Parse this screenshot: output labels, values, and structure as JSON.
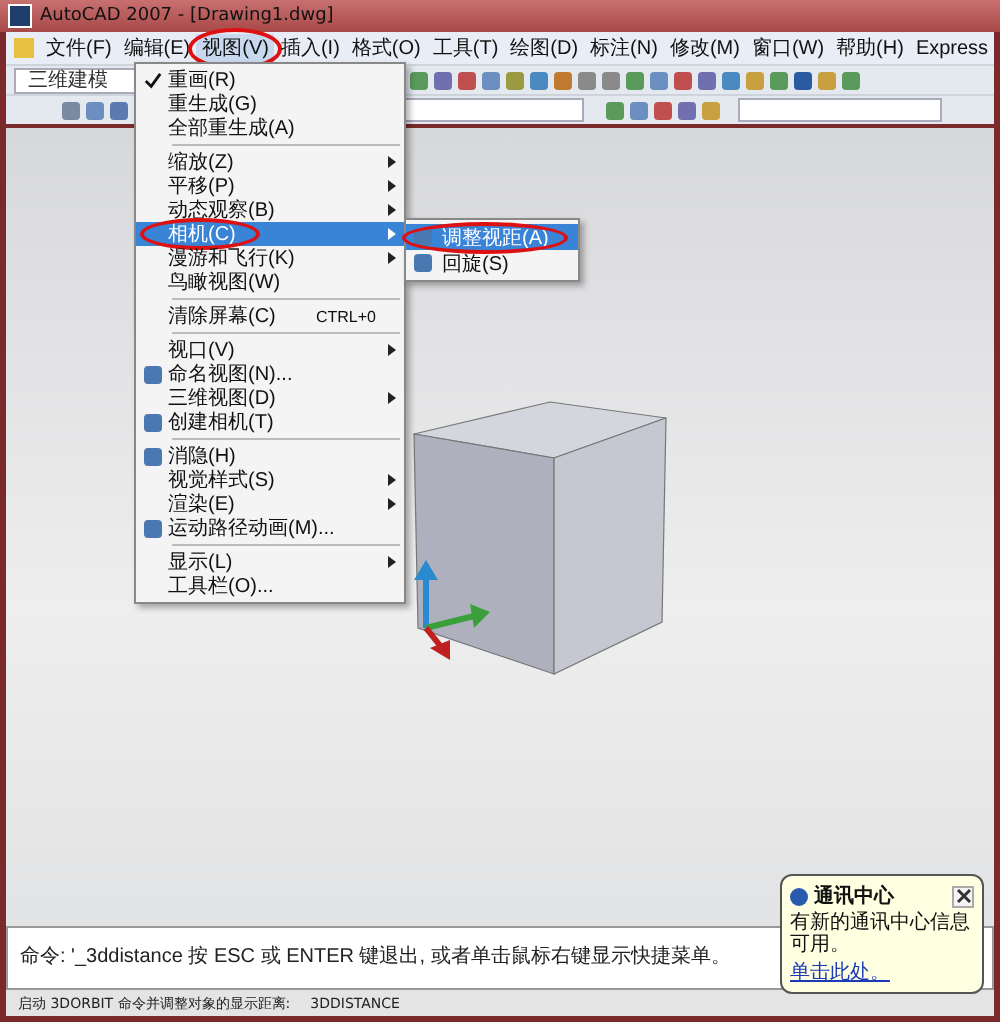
{
  "window": {
    "title": "AutoCAD 2007 - [Drawing1.dwg]"
  },
  "menu_bar": [
    {
      "label": "文件(F)",
      "selected": false
    },
    {
      "label": "编辑(E)",
      "selected": false
    },
    {
      "label": "视图(V)",
      "selected": true
    },
    {
      "label": "插入(I)",
      "selected": false
    },
    {
      "label": "格式(O)",
      "selected": false
    },
    {
      "label": "工具(T)",
      "selected": false
    },
    {
      "label": "绘图(D)",
      "selected": false
    },
    {
      "label": "标注(N)",
      "selected": false
    },
    {
      "label": "修改(M)",
      "selected": false
    },
    {
      "label": "窗口(W)",
      "selected": false
    },
    {
      "label": "帮助(H)",
      "selected": false
    },
    {
      "label": "Express",
      "selected": false
    }
  ],
  "workspace": {
    "value": "三维建模"
  },
  "view_menu": {
    "items": [
      {
        "kind": "item",
        "label": "重画(R)",
        "checked": true,
        "icon": false,
        "submenu": false,
        "selected": false
      },
      {
        "kind": "item",
        "label": "重生成(G)",
        "checked": false,
        "icon": false,
        "submenu": false,
        "selected": false
      },
      {
        "kind": "item",
        "label": "全部重生成(A)",
        "checked": false,
        "icon": false,
        "submenu": false,
        "selected": false
      },
      {
        "kind": "separator"
      },
      {
        "kind": "item",
        "label": "缩放(Z)",
        "checked": false,
        "icon": false,
        "submenu": true,
        "selected": false
      },
      {
        "kind": "item",
        "label": "平移(P)",
        "checked": false,
        "icon": false,
        "submenu": true,
        "selected": false
      },
      {
        "kind": "item",
        "label": "动态观察(B)",
        "checked": false,
        "icon": false,
        "submenu": true,
        "selected": false
      },
      {
        "kind": "item",
        "label": "相机(C)",
        "checked": false,
        "icon": false,
        "submenu": true,
        "selected": true
      },
      {
        "kind": "item",
        "label": "漫游和飞行(K)",
        "checked": false,
        "icon": false,
        "submenu": true,
        "selected": false
      },
      {
        "kind": "item",
        "label": "鸟瞰视图(W)",
        "checked": false,
        "icon": false,
        "submenu": false,
        "selected": false
      },
      {
        "kind": "separator"
      },
      {
        "kind": "item",
        "label": "清除屏幕(C)",
        "shortcut": "CTRL+0",
        "checked": false,
        "icon": false,
        "submenu": false,
        "selected": false
      },
      {
        "kind": "separator"
      },
      {
        "kind": "item",
        "label": "视口(V)",
        "checked": false,
        "icon": false,
        "submenu": true,
        "selected": false
      },
      {
        "kind": "item",
        "label": "命名视图(N)...",
        "checked": false,
        "icon": true,
        "submenu": false,
        "selected": false
      },
      {
        "kind": "item",
        "label": "三维视图(D)",
        "checked": false,
        "icon": false,
        "submenu": true,
        "selected": false
      },
      {
        "kind": "item",
        "label": "创建相机(T)",
        "checked": false,
        "icon": true,
        "submenu": false,
        "selected": false
      },
      {
        "kind": "separator"
      },
      {
        "kind": "item",
        "label": "消隐(H)",
        "checked": false,
        "icon": true,
        "submenu": false,
        "selected": false
      },
      {
        "kind": "item",
        "label": "视觉样式(S)",
        "checked": false,
        "icon": false,
        "submenu": true,
        "selected": false
      },
      {
        "kind": "item",
        "label": "渲染(E)",
        "checked": false,
        "icon": false,
        "submenu": true,
        "selected": false
      },
      {
        "kind": "item",
        "label": "运动路径动画(M)...",
        "checked": false,
        "icon": true,
        "submenu": false,
        "selected": false
      },
      {
        "kind": "separator"
      },
      {
        "kind": "item",
        "label": "显示(L)",
        "checked": false,
        "icon": false,
        "submenu": true,
        "selected": false
      },
      {
        "kind": "item",
        "label": "工具栏(O)...",
        "checked": false,
        "icon": false,
        "submenu": false,
        "selected": false
      }
    ]
  },
  "camera_submenu": {
    "items": [
      {
        "label": "调整视距(A)",
        "selected": true
      },
      {
        "label": "回旋(S)",
        "selected": false
      }
    ]
  },
  "command_line": {
    "text": "命令: '_3ddistance 按 ESC 或 ENTER 键退出, 或者单击鼠标右键显示快捷菜单。"
  },
  "status_bar": {
    "text": "启动 3DORBIT 命令并调整对象的显示距离:",
    "command": "3DDISTANCE"
  },
  "notification": {
    "title": "通讯中心",
    "body": "有新的通讯中心信息可用。",
    "link": "单击此处。"
  }
}
